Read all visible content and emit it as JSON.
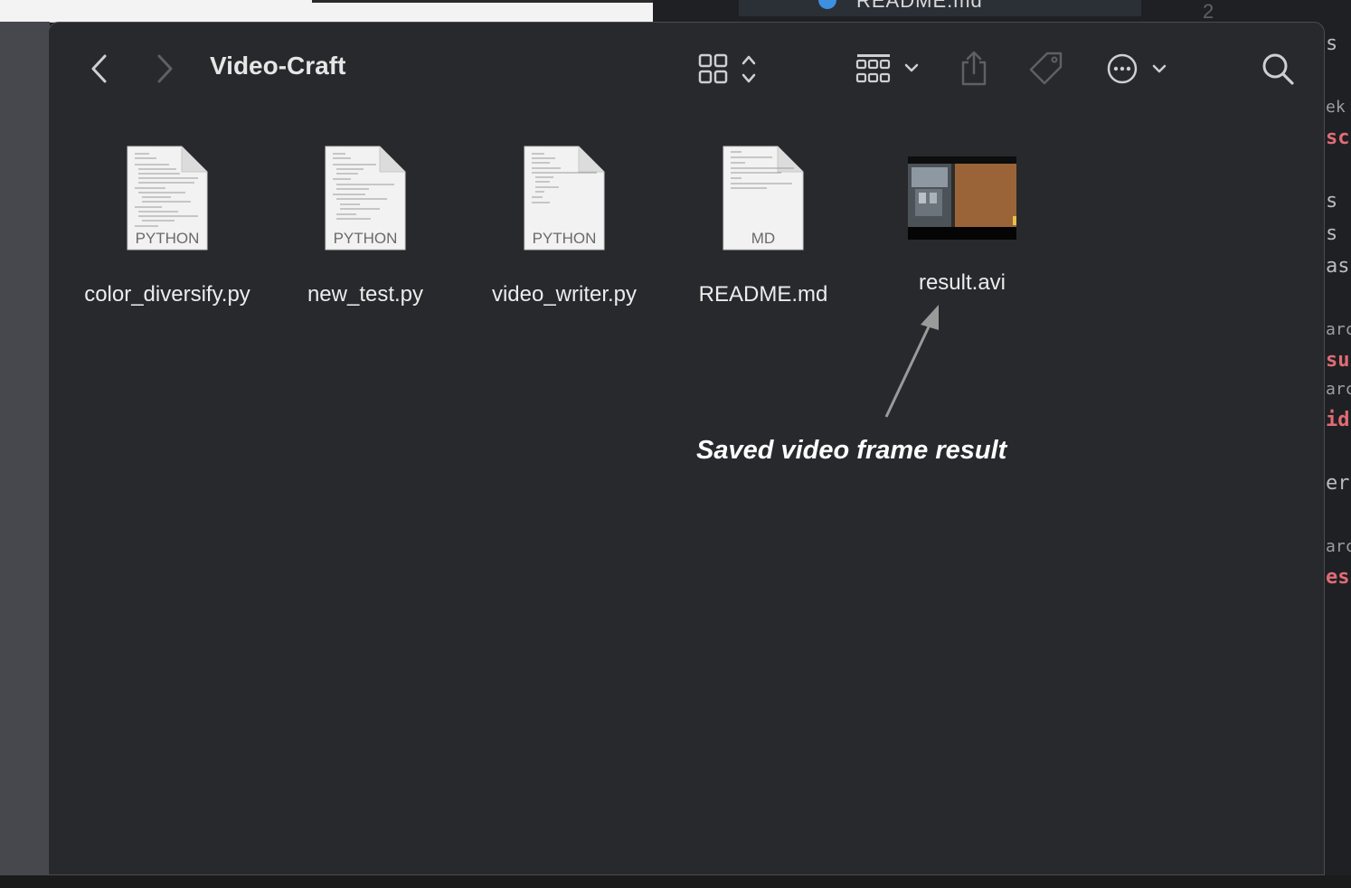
{
  "background_editor": {
    "tab_title": "README.md",
    "line_number": "2",
    "code_fragments": [
      {
        "text": "s",
        "style": "grey"
      },
      {
        "text": "ek",
        "style": "small"
      },
      {
        "text": "sc",
        "style": "red"
      },
      {
        "text": "s",
        "style": "grey"
      },
      {
        "text": "s",
        "style": "grey"
      },
      {
        "text": "as",
        "style": "grey"
      },
      {
        "text": "arc",
        "style": "small"
      },
      {
        "text": "su",
        "style": "red"
      },
      {
        "text": "arc",
        "style": "small"
      },
      {
        "text": "id",
        "style": "red"
      },
      {
        "text": "er",
        "style": "grey"
      },
      {
        "text": "arc",
        "style": "small"
      },
      {
        "text": "es",
        "style": "red"
      }
    ]
  },
  "finder": {
    "title": "Video-Craft",
    "toolbar": {
      "back": "chevron-left-icon",
      "forward": "chevron-right-icon",
      "view": "icon-grid-view-icon",
      "group": "group-by-icon",
      "share": "share-icon",
      "tag": "tag-icon",
      "more": "ellipsis-circle-icon",
      "search": "search-icon"
    },
    "files": [
      {
        "name": "color_diversify.py",
        "kind": "PYTHON"
      },
      {
        "name": "new_test.py",
        "kind": "PYTHON"
      },
      {
        "name": "video_writer.py",
        "kind": "PYTHON"
      },
      {
        "name": "README.md",
        "kind": "MD"
      },
      {
        "name": "result.avi",
        "kind": ""
      }
    ],
    "annotation": "Saved video frame result"
  },
  "colors": {
    "window_bg": "#28292c",
    "text": "#ececec",
    "icon": "#cfcfd1",
    "icon_disabled": "#5f6065",
    "annotation": "#ffffff",
    "arrow": "#9a9a9a"
  }
}
